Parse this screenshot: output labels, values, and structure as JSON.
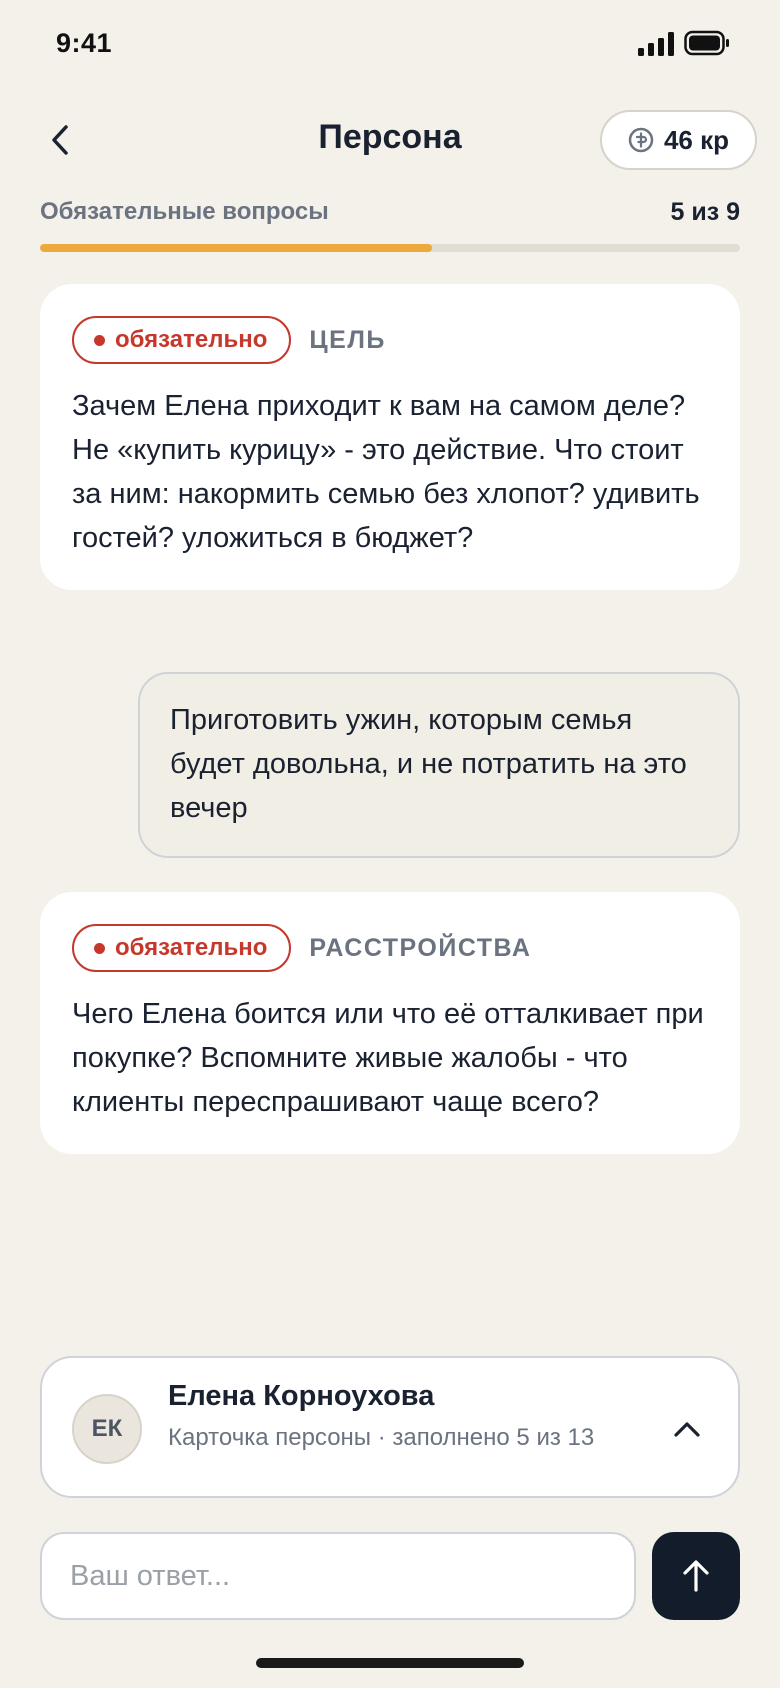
{
  "status_bar": {
    "time": "9:41"
  },
  "header": {
    "title": "Персона",
    "credits": "46 кр"
  },
  "progress": {
    "label": "Обязательные вопросы",
    "count": "5 из 9",
    "fraction": 0.56
  },
  "questions": [
    {
      "badge": "обязательно",
      "category": "ЦЕЛЬ",
      "text": "Зачем Елена приходит к вам на самом деле? Не «купить курицу» - это действие. Что стоит за ним: накормить семью без хлопот? удивить гостей? уложиться в бюджет?"
    },
    {
      "badge": "обязательно",
      "category": "РАССТРОЙСТВА",
      "text": "Чего Елена боится или что её отталкивает при покупке? Вспомните живые жалобы - что клиенты переспрашивают чаще всего?"
    }
  ],
  "answer": {
    "text": "Приготовить ужин, которым семья будет довольна, и не потратить на это вечер"
  },
  "persona": {
    "initials": "ЕК",
    "name": "Елена Корноухова",
    "subtitle": "Карточка персоны · заполнено 5 из 13"
  },
  "composer": {
    "placeholder": "Ваш ответ..."
  },
  "colors": {
    "background": "#f4f1eb",
    "accent_progress": "#eda93c",
    "required_red": "#c6382b",
    "send_button": "#131c2b"
  },
  "icons": {
    "back": "chevron-left-icon",
    "credits": "coin-icon",
    "expand": "chevron-up-icon",
    "send": "arrow-up-icon"
  }
}
